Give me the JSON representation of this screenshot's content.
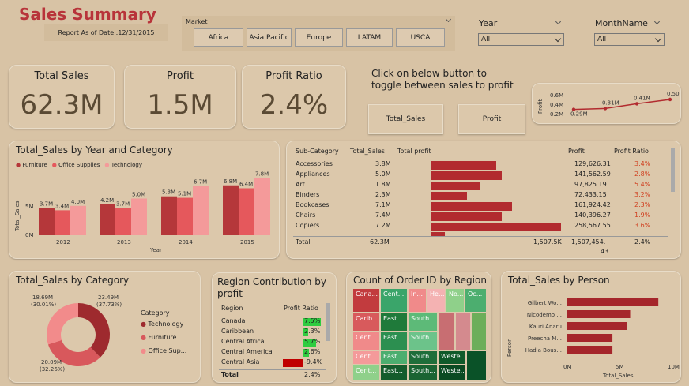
{
  "header": {
    "title": "Sales Summary",
    "report_date": "Report As of Date :12/31/2015"
  },
  "market": {
    "label": "Market",
    "options": [
      "Africa",
      "Asia Pacific",
      "Europe",
      "LATAM",
      "USCA"
    ]
  },
  "year_filter": {
    "label": "Year",
    "value": "All"
  },
  "month_filter": {
    "label": "MonthName",
    "value": "All"
  },
  "kpis": [
    {
      "label": "Total Sales",
      "value": "62.3M"
    },
    {
      "label": "Profit",
      "value": "1.5M"
    },
    {
      "label": "Profit Ratio",
      "value": "2.4%"
    }
  ],
  "toggle": {
    "text": "Click on below button to toggle between sales to profit",
    "btn_sales": "Total_Sales",
    "btn_profit": "Profit"
  },
  "spark": {
    "ylabel": "Profit",
    "ticks": [
      "0.6M",
      "0.4M",
      "0.2M"
    ],
    "labels": [
      "0.29M",
      "0.31M",
      "0.41M",
      "0.50M"
    ],
    "values": [
      0.29,
      0.31,
      0.41,
      0.5
    ]
  },
  "year_cat": {
    "title": "Total_Sales by Year and Category",
    "legend": [
      "Furniture",
      "Office Supplies",
      "Technology"
    ],
    "colors": [
      "#b5373a",
      "#e5585c",
      "#f49a9a"
    ],
    "ylabel": "Total_Sales",
    "xlabel": "Year",
    "yticks": [
      "5M",
      "0M"
    ],
    "chart_data": {
      "type": "bar",
      "categories": [
        "2012",
        "2013",
        "2014",
        "2015"
      ],
      "series": [
        {
          "name": "Furniture",
          "values": [
            3.7,
            4.2,
            5.3,
            6.8
          ],
          "labels": [
            "3.7M",
            "4.2M",
            "5.3M",
            "6.8M"
          ]
        },
        {
          "name": "Office Supplies",
          "values": [
            3.4,
            3.7,
            5.1,
            6.4
          ],
          "labels": [
            "3.4M",
            "3.7M",
            "5.1M",
            "6.4M"
          ]
        },
        {
          "name": "Technology",
          "values": [
            4.0,
            5.0,
            6.7,
            7.8
          ],
          "labels": [
            "4.0M",
            "5.0M",
            "6.7M",
            "7.8M"
          ]
        }
      ],
      "ylim": [
        0,
        8
      ]
    }
  },
  "subcat": {
    "headers": {
      "sub": "Sub-Category",
      "sales": "Total_Sales",
      "tp": "Total profit",
      "profit": "Profit",
      "ratio": "Profit Ratio"
    },
    "rows": [
      {
        "name": "Accessories",
        "sales": "3.8M",
        "profit": "129,626.31",
        "ratio": "3.4%",
        "pv": 129626
      },
      {
        "name": "Appliances",
        "sales": "5.0M",
        "profit": "141,562.59",
        "ratio": "2.8%",
        "pv": 141563
      },
      {
        "name": "Art",
        "sales": "1.8M",
        "profit": "97,825.19",
        "ratio": "5.4%",
        "pv": 97825
      },
      {
        "name": "Binders",
        "sales": "2.3M",
        "profit": "72,433.15",
        "ratio": "3.2%",
        "pv": 72433
      },
      {
        "name": "Bookcases",
        "sales": "7.1M",
        "profit": "161,924.42",
        "ratio": "2.3%",
        "pv": 161924
      },
      {
        "name": "Chairs",
        "sales": "7.4M",
        "profit": "140,396.27",
        "ratio": "1.9%",
        "pv": 140396
      },
      {
        "name": "Copiers",
        "sales": "7.2M",
        "profit": "258,567.55",
        "ratio": "3.6%",
        "pv": 258568
      }
    ],
    "total": {
      "label": "Total",
      "sales": "62.3M",
      "tp": "1,507.5K",
      "profit": "1,507,454.",
      "profit2": "43",
      "ratio": "2.4%"
    }
  },
  "donut": {
    "title": "Total_Sales by Category",
    "legend_title": "Category",
    "legend": [
      "Technology",
      "Furniture",
      "Office Sup..."
    ],
    "chart_data": {
      "type": "pie",
      "labels": [
        "Technology",
        "Office Supplies",
        "Furniture"
      ],
      "values": [
        23.49,
        20.09,
        18.69
      ],
      "texts": [
        [
          "23.49M",
          "(37.73%)"
        ],
        [
          "20.09M",
          "(32.26%)"
        ],
        [
          "18.69M",
          "(30.01%)"
        ]
      ],
      "colors": [
        "#9e2a2e",
        "#d8585c",
        "#f28b8b"
      ]
    }
  },
  "region": {
    "title": "Region Contribution by profit",
    "headers": {
      "region": "Region",
      "ratio": "Profit Ratio"
    },
    "rows": [
      {
        "name": "Canada",
        "ratio": "7.5%",
        "v": 7.5
      },
      {
        "name": "Caribbean",
        "ratio": "2.3%",
        "v": 2.3
      },
      {
        "name": "Central Africa",
        "ratio": "5.7%",
        "v": 5.7
      },
      {
        "name": "Central America",
        "ratio": "2.6%",
        "v": 2.6
      },
      {
        "name": "Central Asia",
        "ratio": "-9.4%",
        "v": -9.4
      }
    ],
    "total": {
      "label": "Total",
      "ratio": "2.4%"
    }
  },
  "treemap": {
    "title": "Count of Order ID by Region",
    "tiles": [
      "Cana...",
      "Cent...",
      "In...",
      "He...",
      "No...",
      "Oc...",
      "Carib...",
      "East...",
      "South ...",
      "Cent...",
      "East...",
      "South...",
      "Cent...",
      "East...",
      "South...",
      "Weste...",
      "Cent...",
      "East...",
      "South...",
      "Weste..."
    ]
  },
  "person": {
    "title": "Total_Sales by Person",
    "ylabel": "Person",
    "xlabel": "Total_Sales",
    "xticks": [
      "0M",
      "5M",
      "10M"
    ],
    "chart_data": {
      "type": "bar",
      "categories": [
        "Gilbert Wo...",
        "Nicodemo ...",
        "Kauri Anaru",
        "Preecha M...",
        "Hadia Bous..."
      ],
      "values": [
        8.8,
        6.1,
        5.8,
        4.4,
        4.4
      ],
      "xlim": [
        0,
        10
      ]
    }
  }
}
